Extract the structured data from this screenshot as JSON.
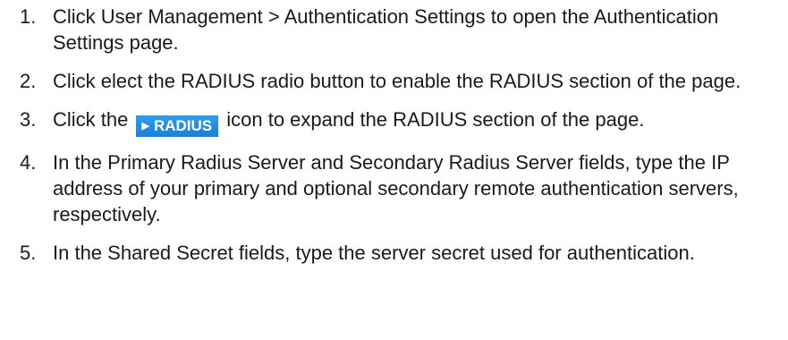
{
  "steps": [
    {
      "number": "1.",
      "text": "Click User Management > Authentication Settings to open the Authentication Settings page."
    },
    {
      "number": "2.",
      "text": "Click elect the RADIUS radio button to enable the RADIUS section of the page."
    },
    {
      "number": "3.",
      "before": "Click the ",
      "icon_label": "RADIUS",
      "icon_glyph": "▶",
      "after": " icon to expand the RADIUS section of the page."
    },
    {
      "number": "4.",
      "text": "In the Primary Radius Server and Secondary Radius Server fields, type the IP address of your primary and optional secondary remote authentication servers, respectively."
    },
    {
      "number": "5.",
      "text": "In the Shared Secret fields, type the server secret used for authentication."
    }
  ],
  "colors": {
    "text": "#1a1a1a",
    "chip_background": "#1b7fd6",
    "chip_text": "#ffffff"
  }
}
